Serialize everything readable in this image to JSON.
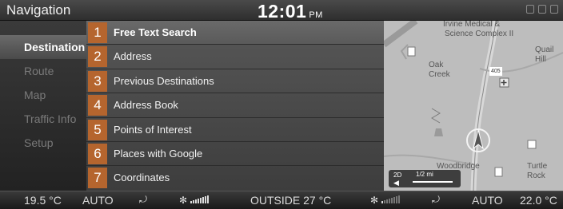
{
  "header": {
    "title": "Navigation",
    "time": "12:01",
    "ampm": "PM"
  },
  "categories": [
    {
      "label": "Destination",
      "active": true
    },
    {
      "label": "Route",
      "active": false
    },
    {
      "label": "Map",
      "active": false
    },
    {
      "label": "Traffic Info",
      "active": false
    },
    {
      "label": "Setup",
      "active": false
    }
  ],
  "menu": [
    {
      "number": "1",
      "label": "Free Text Search",
      "selected": true
    },
    {
      "number": "2",
      "label": "Address",
      "selected": false
    },
    {
      "number": "3",
      "label": "Previous Destinations",
      "selected": false
    },
    {
      "number": "4",
      "label": "Address Book",
      "selected": false
    },
    {
      "number": "5",
      "label": "Points of Interest",
      "selected": false
    },
    {
      "number": "6",
      "label": "Places with Google",
      "selected": false
    },
    {
      "number": "7",
      "label": "Coordinates",
      "selected": false
    }
  ],
  "map": {
    "places": [
      "Irvine Medical &",
      "Science Complex II",
      "Oak",
      "Creek",
      "Quail",
      "Hill",
      "Woodbridge",
      "Turtle",
      "Rock"
    ],
    "highway": "405",
    "view_mode": "2D",
    "scale": "1/2 mi"
  },
  "climate": {
    "left_temp": "19.5 °C",
    "left_mode": "AUTO",
    "outside": "OUTSIDE 27 °C",
    "right_mode": "AUTO",
    "right_temp": "22.0 °C",
    "fan_left_level": 1.0,
    "fan_right_level": 0.0
  },
  "colors": {
    "accent_number_bg": "#b5652e",
    "map_bg": "#bcbcbc"
  }
}
